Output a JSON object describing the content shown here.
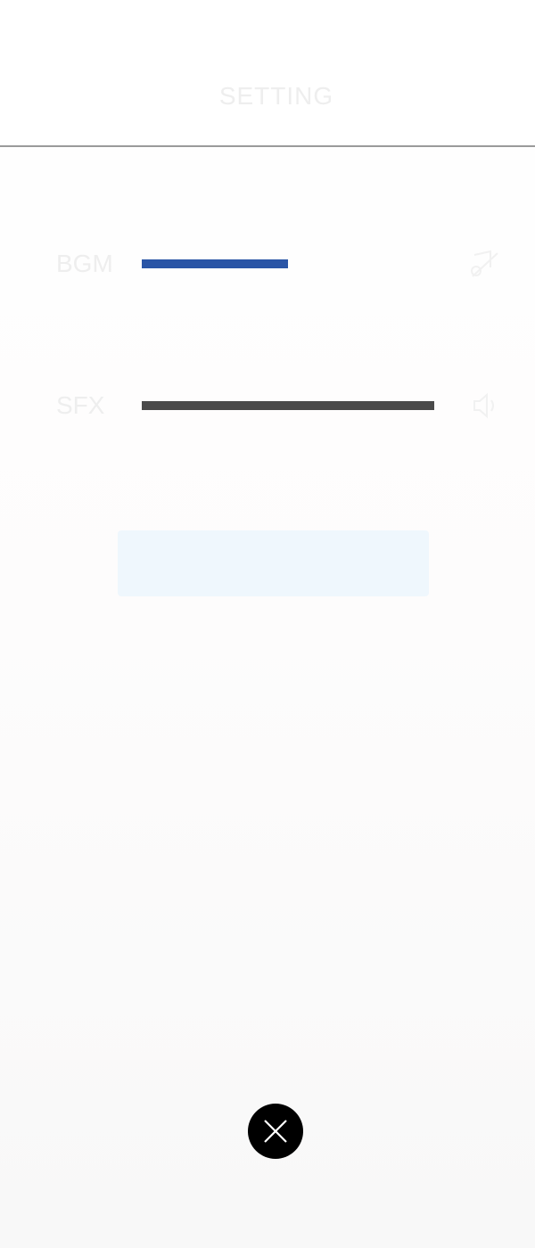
{
  "header": {
    "title": "SETTING"
  },
  "settings": {
    "bgm": {
      "label": "BGM",
      "level": 0.5,
      "fill_color": "#2a55a6",
      "icon": "music-note-off-icon"
    },
    "sfx": {
      "label": "SFX",
      "level": 1.0,
      "fill_color": "#4a4a4a",
      "icon": "speaker-icon"
    }
  },
  "action_box": {
    "background": "#eff7fd"
  },
  "close": {
    "icon": "close-icon",
    "background": "#000000"
  },
  "colors": {
    "faint_text": "#eeeeee",
    "divider": "#9a9a9a"
  }
}
